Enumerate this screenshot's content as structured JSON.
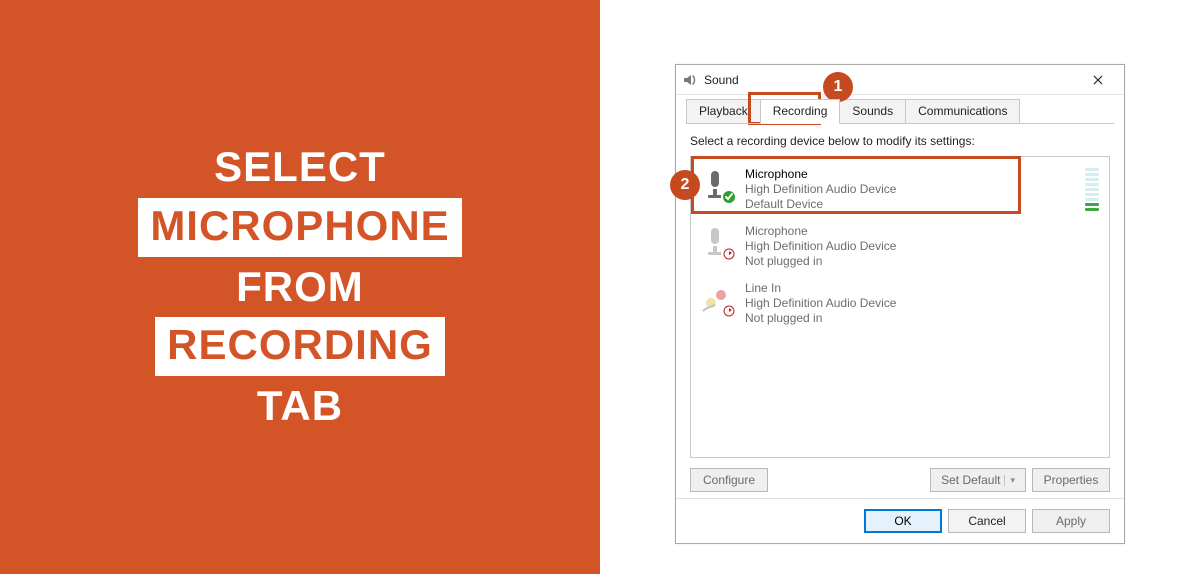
{
  "headline": {
    "line1": "SELECT",
    "line2": "MICROPHONE",
    "line3": "FROM",
    "line4": "RECORDING",
    "line5": "TAB"
  },
  "callouts": {
    "one": "1",
    "two": "2"
  },
  "dialog": {
    "title": "Sound",
    "tabs": {
      "playback": "Playback",
      "recording": "Recording",
      "sounds": "Sounds",
      "communications": "Communications"
    },
    "hint": "Select a recording device below to modify its settings:",
    "devices": [
      {
        "name": "Microphone",
        "sub1": "High Definition Audio Device",
        "sub2": "Default Device",
        "status": "default"
      },
      {
        "name": "Microphone",
        "sub1": "High Definition Audio Device",
        "sub2": "Not plugged in",
        "status": "unplugged"
      },
      {
        "name": "Line In",
        "sub1": "High Definition Audio Device",
        "sub2": "Not plugged in",
        "status": "unplugged"
      }
    ],
    "buttons": {
      "configure": "Configure",
      "setdefault": "Set Default",
      "properties": "Properties",
      "ok": "OK",
      "cancel": "Cancel",
      "apply": "Apply"
    }
  }
}
